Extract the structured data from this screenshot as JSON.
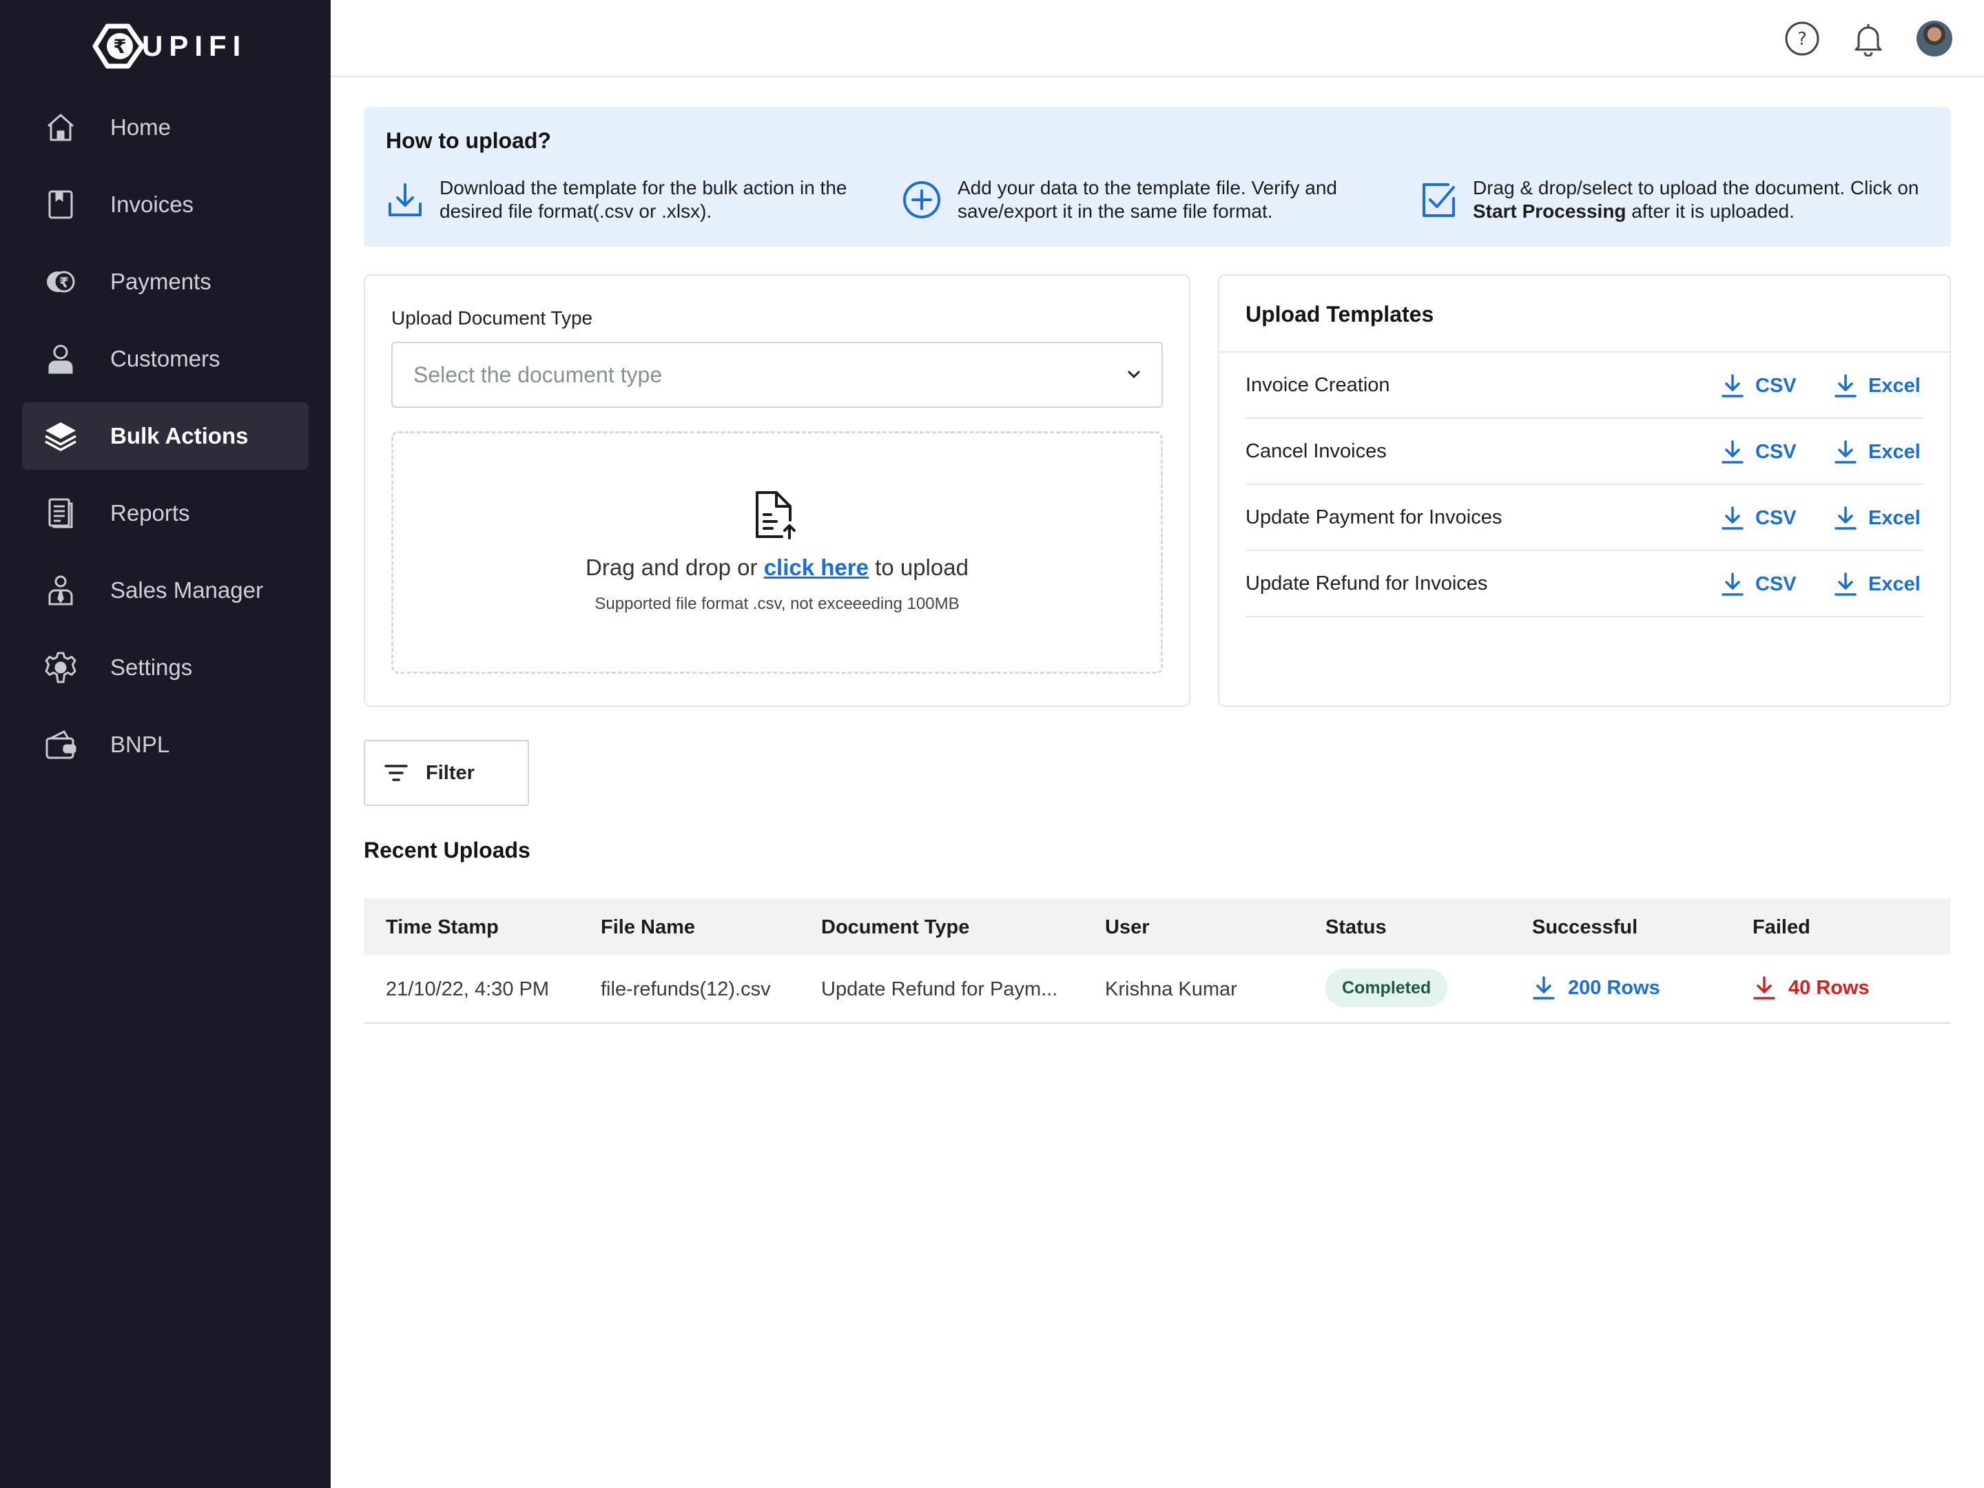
{
  "app": {
    "logo_text": "UPIFI",
    "logo_symbol": "₹"
  },
  "sidebar": {
    "items": [
      {
        "label": "Home",
        "icon": "home-icon"
      },
      {
        "label": "Invoices",
        "icon": "invoice-icon"
      },
      {
        "label": "Payments",
        "icon": "rupee-coin-icon"
      },
      {
        "label": "Customers",
        "icon": "user-icon"
      },
      {
        "label": "Bulk Actions",
        "icon": "layers-icon",
        "active": true
      },
      {
        "label": "Reports",
        "icon": "report-icon"
      },
      {
        "label": "Sales Manager",
        "icon": "manager-icon"
      },
      {
        "label": "Settings",
        "icon": "gear-icon"
      },
      {
        "label": "BNPL",
        "icon": "wallet-icon"
      }
    ]
  },
  "topbar": {
    "icons": [
      "help-icon",
      "bell-icon",
      "avatar"
    ]
  },
  "howto": {
    "title": "How to upload?",
    "steps": [
      {
        "icon": "download-icon",
        "text": "Download the template for the bulk action in the desired file format(.csv or .xlsx)."
      },
      {
        "icon": "plus-circle-icon",
        "text": "Add your data to the template file. Verify and save/export it in the same file format."
      },
      {
        "icon": "checkbox-icon",
        "text_before": "Drag & drop/select to upload the document. Click on ",
        "text_bold": "Start Processing",
        "text_after": " after it is uploaded."
      }
    ]
  },
  "upload": {
    "label": "Upload Document Type",
    "placeholder": "Select the document type",
    "drop_prefix": "Drag and drop or ",
    "drop_link": "click here",
    "drop_suffix": " to upload",
    "supported": "Supported file format .csv, not exceeeding 100MB"
  },
  "templates": {
    "title": "Upload Templates",
    "csv_label": "CSV",
    "excel_label": "Excel",
    "rows": [
      {
        "name": "Invoice Creation"
      },
      {
        "name": "Cancel Invoices"
      },
      {
        "name": "Update Payment for Invoices"
      },
      {
        "name": "Update Refund for Invoices"
      }
    ]
  },
  "filter": {
    "label": "Filter"
  },
  "recent": {
    "title": "Recent Uploads",
    "columns": [
      "Time Stamp",
      "File Name",
      "Document Type",
      "User",
      "Status",
      "Successful",
      "Failed"
    ],
    "rows": [
      {
        "timestamp": "21/10/22, 4:30 PM",
        "file_name": "file-refunds(12).csv",
        "document_type": "Update Refund for Paym...",
        "user": "Krishna Kumar",
        "status": "Completed",
        "successful": "200 Rows",
        "failed": "40 Rows"
      }
    ]
  },
  "colors": {
    "sidebar_bg": "#191a25",
    "accent_blue": "#1a6ed6",
    "error_red": "#d32020",
    "success_bg": "#e3f4ef",
    "info_bg": "#e6effc"
  }
}
